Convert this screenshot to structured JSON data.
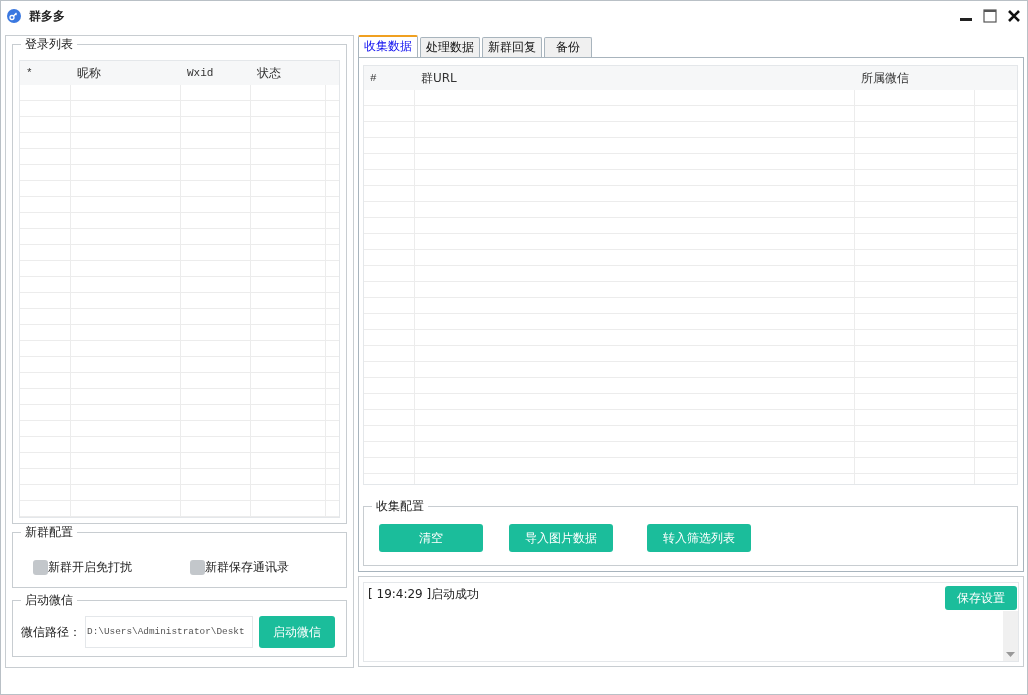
{
  "window": {
    "title": "群多多"
  },
  "login_list": {
    "title": "登录列表",
    "columns": [
      "*",
      "昵称",
      "Wxid",
      "状态"
    ]
  },
  "new_group_config": {
    "title": "新群配置",
    "options": [
      {
        "label": "新群开启免打扰",
        "checked": false
      },
      {
        "label": "新群保存通讯录",
        "checked": false
      }
    ]
  },
  "launch": {
    "title": "启动微信",
    "path_label": "微信路径：",
    "path_value": "D:\\Users\\Administrator\\Deskt",
    "button": "启动微信"
  },
  "tabs": [
    {
      "label": "收集数据",
      "selected": true
    },
    {
      "label": "处理数据",
      "selected": false
    },
    {
      "label": "新群回复",
      "selected": false
    },
    {
      "label": "备份",
      "selected": false
    }
  ],
  "collect_table": {
    "columns": [
      "#",
      "群URL",
      "所属微信"
    ]
  },
  "collect_config": {
    "title": "收集配置",
    "buttons": [
      "清空",
      "导入图片数据",
      "转入筛选列表"
    ]
  },
  "log": {
    "lines": [
      "[ 19:4:29 ]启动成功"
    ]
  },
  "save_button": "保存设置"
}
